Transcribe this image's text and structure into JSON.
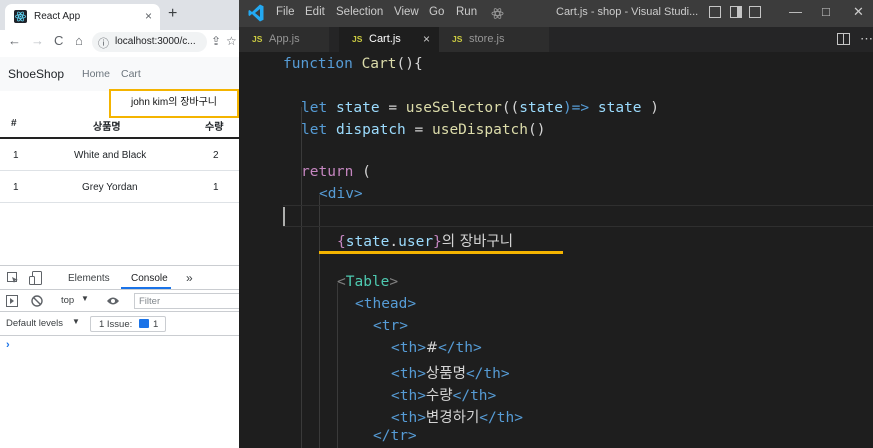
{
  "browser": {
    "tab_title": "React App",
    "tab_close": "×",
    "new_tab": "+",
    "url": "localhost:3000/c...",
    "nav": {
      "back": "←",
      "forward": "→",
      "reload": "C",
      "home": "⌂",
      "info": "ⓘ"
    },
    "toolbar_icons": {
      "share": "⇪",
      "star": "☆",
      "extension": "□"
    }
  },
  "app": {
    "brand": "ShoeShop",
    "nav_links": [
      "Home",
      "Cart"
    ],
    "cart_title": "john kim의 장바구니",
    "table": {
      "headers": [
        "#",
        "상품명",
        "수량"
      ],
      "rows": [
        [
          "1",
          "White and Black",
          "2"
        ],
        [
          "1",
          "Grey Yordan",
          "1"
        ]
      ]
    }
  },
  "devtools": {
    "tabs": [
      "Elements",
      "Console"
    ],
    "more": "»",
    "context": "top",
    "filter_placeholder": "Filter",
    "levels": "Default levels",
    "issues_label": "1 Issue:",
    "issues_count": "1",
    "prompt": "›"
  },
  "vscode": {
    "menu": [
      "File",
      "Edit",
      "Selection",
      "View",
      "Go",
      "Run"
    ],
    "window_title": "Cart.js - shop - Visual Studi...",
    "tabs": [
      {
        "label": "App.js",
        "icon": "JS"
      },
      {
        "label": "Cart.js",
        "icon": "JS"
      },
      {
        "label": "store.js",
        "icon": "JS"
      }
    ],
    "tab_close": "×",
    "window_controls": {
      "minimize": "—",
      "maximize": "□",
      "close": "✕"
    },
    "code": {
      "l1_kw": "function",
      "l1_fn": "Cart",
      "l1_rest": "(){",
      "l2_kw": "let",
      "l2_var": "state",
      "l2_eq": " = ",
      "l2_fn": "useSelector",
      "l2_p1": "((",
      "l2_arg": "state",
      "l2_arrow": ")=>",
      "l2_ret": " state ",
      "l2_close": ")",
      "l3_kw": "let",
      "l3_var": "dispatch",
      "l3_eq": " = ",
      "l3_fn": "useDispatch",
      "l3_close": "()",
      "l4_kw": "return",
      "l4_paren": " (",
      "l5": "<div>",
      "l6_b1": "{",
      "l6_obj": "state",
      "l6_dot": ".",
      "l6_prop": "user",
      "l6_b2": "}",
      "l6_text": "의 장바구니",
      "l7_lt": "<",
      "l7_tag": "Table",
      "l7_gt": ">",
      "l8": "<thead>",
      "l9": "<tr>",
      "th_open": "<th>",
      "th_close": "</th>",
      "th1": "#",
      "th2": "상품명",
      "th3": "수량",
      "th4": "변경하기",
      "l14": "</tr>"
    }
  }
}
